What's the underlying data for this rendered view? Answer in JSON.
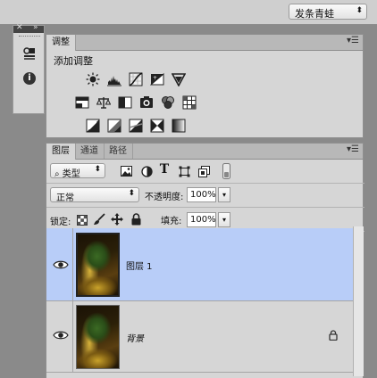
{
  "topbar": {
    "preset_select": {
      "value": "发条青蛙",
      "arrow": "⬍"
    }
  },
  "side_strip": {
    "close": "✕",
    "collapse": "»",
    "icons": [
      "adjustment-stack-icon",
      "info-icon"
    ],
    "info_glyph": "i"
  },
  "adjustments_panel": {
    "tabs": [
      {
        "label": "调整",
        "active": true
      }
    ],
    "menu": "▾☰",
    "title": "添加调整",
    "icon_rows": [
      [
        "brightness-icon",
        "levels-icon",
        "curves-icon",
        "exposure-icon",
        "vibrance-icon"
      ],
      [
        "hue-saturation-icon",
        "color-balance-icon",
        "black-white-icon",
        "photo-filter-icon",
        "channel-mixer-icon",
        "color-lookup-icon"
      ],
      [
        "invert-icon",
        "posterize-icon",
        "threshold-icon",
        "selective-color-icon",
        "gradient-map-icon"
      ]
    ]
  },
  "layers_panel": {
    "tabs": [
      {
        "label": "图层",
        "active": true
      },
      {
        "label": "通道",
        "active": false
      },
      {
        "label": "路径",
        "active": false
      }
    ],
    "menu": "▾☰",
    "filter": {
      "search_glyph": "⌕",
      "kind_label": "类型",
      "arrow": "⬍",
      "icons": [
        "filter-pixel-icon",
        "filter-adjustment-icon",
        "filter-type-icon",
        "filter-shape-icon",
        "filter-smart-object-icon",
        "filter-toggle-icon"
      ],
      "type_glyph": "T"
    },
    "blend": {
      "mode": "正常",
      "arrow": "⬍",
      "opacity_label": "不透明度:",
      "opacity_value": "100%",
      "drop": "▾"
    },
    "lock": {
      "label": "锁定:",
      "icons": [
        "lock-transparent-icon",
        "lock-pixels-icon",
        "lock-position-icon",
        "lock-all-icon"
      ],
      "fill_label": "填充:",
      "fill_value": "100%",
      "drop": "▾"
    },
    "layers": [
      {
        "name": "图层 1",
        "visible": true,
        "selected": true,
        "italic": false,
        "locked": false
      },
      {
        "name": "背景",
        "visible": true,
        "selected": false,
        "italic": true,
        "locked": true
      }
    ]
  },
  "colors": {
    "selection": "#b8cdf8",
    "panel_bg": "#d6d6d6",
    "app_bg": "#8a8a8a"
  }
}
